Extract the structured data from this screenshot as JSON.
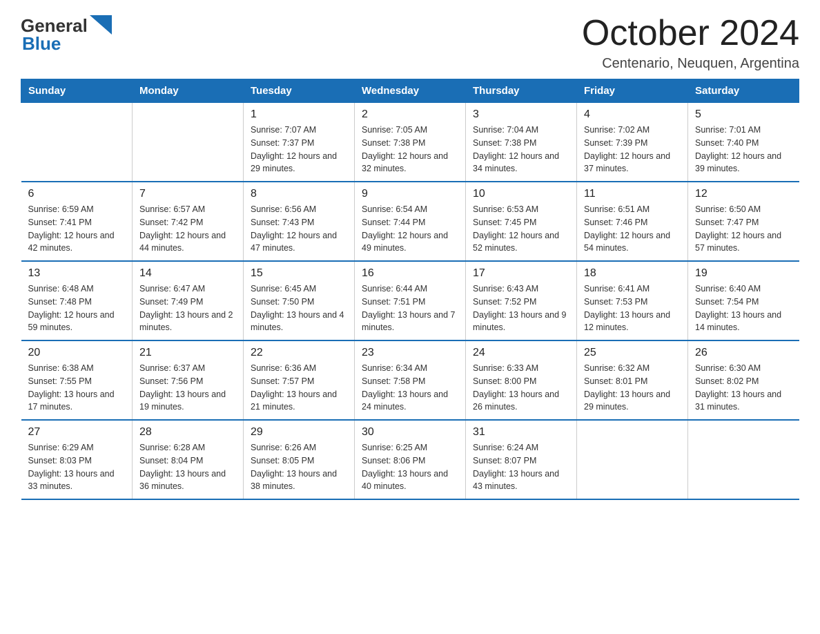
{
  "logo": {
    "text_black": "General",
    "text_blue": "Blue",
    "triangle_color": "#1a6eb5"
  },
  "title": "October 2024",
  "subtitle": "Centenario, Neuquen, Argentina",
  "header_days": [
    "Sunday",
    "Monday",
    "Tuesday",
    "Wednesday",
    "Thursday",
    "Friday",
    "Saturday"
  ],
  "weeks": [
    [
      {
        "day": "",
        "info": ""
      },
      {
        "day": "",
        "info": ""
      },
      {
        "day": "1",
        "info": "Sunrise: 7:07 AM\nSunset: 7:37 PM\nDaylight: 12 hours\nand 29 minutes."
      },
      {
        "day": "2",
        "info": "Sunrise: 7:05 AM\nSunset: 7:38 PM\nDaylight: 12 hours\nand 32 minutes."
      },
      {
        "day": "3",
        "info": "Sunrise: 7:04 AM\nSunset: 7:38 PM\nDaylight: 12 hours\nand 34 minutes."
      },
      {
        "day": "4",
        "info": "Sunrise: 7:02 AM\nSunset: 7:39 PM\nDaylight: 12 hours\nand 37 minutes."
      },
      {
        "day": "5",
        "info": "Sunrise: 7:01 AM\nSunset: 7:40 PM\nDaylight: 12 hours\nand 39 minutes."
      }
    ],
    [
      {
        "day": "6",
        "info": "Sunrise: 6:59 AM\nSunset: 7:41 PM\nDaylight: 12 hours\nand 42 minutes."
      },
      {
        "day": "7",
        "info": "Sunrise: 6:57 AM\nSunset: 7:42 PM\nDaylight: 12 hours\nand 44 minutes."
      },
      {
        "day": "8",
        "info": "Sunrise: 6:56 AM\nSunset: 7:43 PM\nDaylight: 12 hours\nand 47 minutes."
      },
      {
        "day": "9",
        "info": "Sunrise: 6:54 AM\nSunset: 7:44 PM\nDaylight: 12 hours\nand 49 minutes."
      },
      {
        "day": "10",
        "info": "Sunrise: 6:53 AM\nSunset: 7:45 PM\nDaylight: 12 hours\nand 52 minutes."
      },
      {
        "day": "11",
        "info": "Sunrise: 6:51 AM\nSunset: 7:46 PM\nDaylight: 12 hours\nand 54 minutes."
      },
      {
        "day": "12",
        "info": "Sunrise: 6:50 AM\nSunset: 7:47 PM\nDaylight: 12 hours\nand 57 minutes."
      }
    ],
    [
      {
        "day": "13",
        "info": "Sunrise: 6:48 AM\nSunset: 7:48 PM\nDaylight: 12 hours\nand 59 minutes."
      },
      {
        "day": "14",
        "info": "Sunrise: 6:47 AM\nSunset: 7:49 PM\nDaylight: 13 hours\nand 2 minutes."
      },
      {
        "day": "15",
        "info": "Sunrise: 6:45 AM\nSunset: 7:50 PM\nDaylight: 13 hours\nand 4 minutes."
      },
      {
        "day": "16",
        "info": "Sunrise: 6:44 AM\nSunset: 7:51 PM\nDaylight: 13 hours\nand 7 minutes."
      },
      {
        "day": "17",
        "info": "Sunrise: 6:43 AM\nSunset: 7:52 PM\nDaylight: 13 hours\nand 9 minutes."
      },
      {
        "day": "18",
        "info": "Sunrise: 6:41 AM\nSunset: 7:53 PM\nDaylight: 13 hours\nand 12 minutes."
      },
      {
        "day": "19",
        "info": "Sunrise: 6:40 AM\nSunset: 7:54 PM\nDaylight: 13 hours\nand 14 minutes."
      }
    ],
    [
      {
        "day": "20",
        "info": "Sunrise: 6:38 AM\nSunset: 7:55 PM\nDaylight: 13 hours\nand 17 minutes."
      },
      {
        "day": "21",
        "info": "Sunrise: 6:37 AM\nSunset: 7:56 PM\nDaylight: 13 hours\nand 19 minutes."
      },
      {
        "day": "22",
        "info": "Sunrise: 6:36 AM\nSunset: 7:57 PM\nDaylight: 13 hours\nand 21 minutes."
      },
      {
        "day": "23",
        "info": "Sunrise: 6:34 AM\nSunset: 7:58 PM\nDaylight: 13 hours\nand 24 minutes."
      },
      {
        "day": "24",
        "info": "Sunrise: 6:33 AM\nSunset: 8:00 PM\nDaylight: 13 hours\nand 26 minutes."
      },
      {
        "day": "25",
        "info": "Sunrise: 6:32 AM\nSunset: 8:01 PM\nDaylight: 13 hours\nand 29 minutes."
      },
      {
        "day": "26",
        "info": "Sunrise: 6:30 AM\nSunset: 8:02 PM\nDaylight: 13 hours\nand 31 minutes."
      }
    ],
    [
      {
        "day": "27",
        "info": "Sunrise: 6:29 AM\nSunset: 8:03 PM\nDaylight: 13 hours\nand 33 minutes."
      },
      {
        "day": "28",
        "info": "Sunrise: 6:28 AM\nSunset: 8:04 PM\nDaylight: 13 hours\nand 36 minutes."
      },
      {
        "day": "29",
        "info": "Sunrise: 6:26 AM\nSunset: 8:05 PM\nDaylight: 13 hours\nand 38 minutes."
      },
      {
        "day": "30",
        "info": "Sunrise: 6:25 AM\nSunset: 8:06 PM\nDaylight: 13 hours\nand 40 minutes."
      },
      {
        "day": "31",
        "info": "Sunrise: 6:24 AM\nSunset: 8:07 PM\nDaylight: 13 hours\nand 43 minutes."
      },
      {
        "day": "",
        "info": ""
      },
      {
        "day": "",
        "info": ""
      }
    ]
  ]
}
